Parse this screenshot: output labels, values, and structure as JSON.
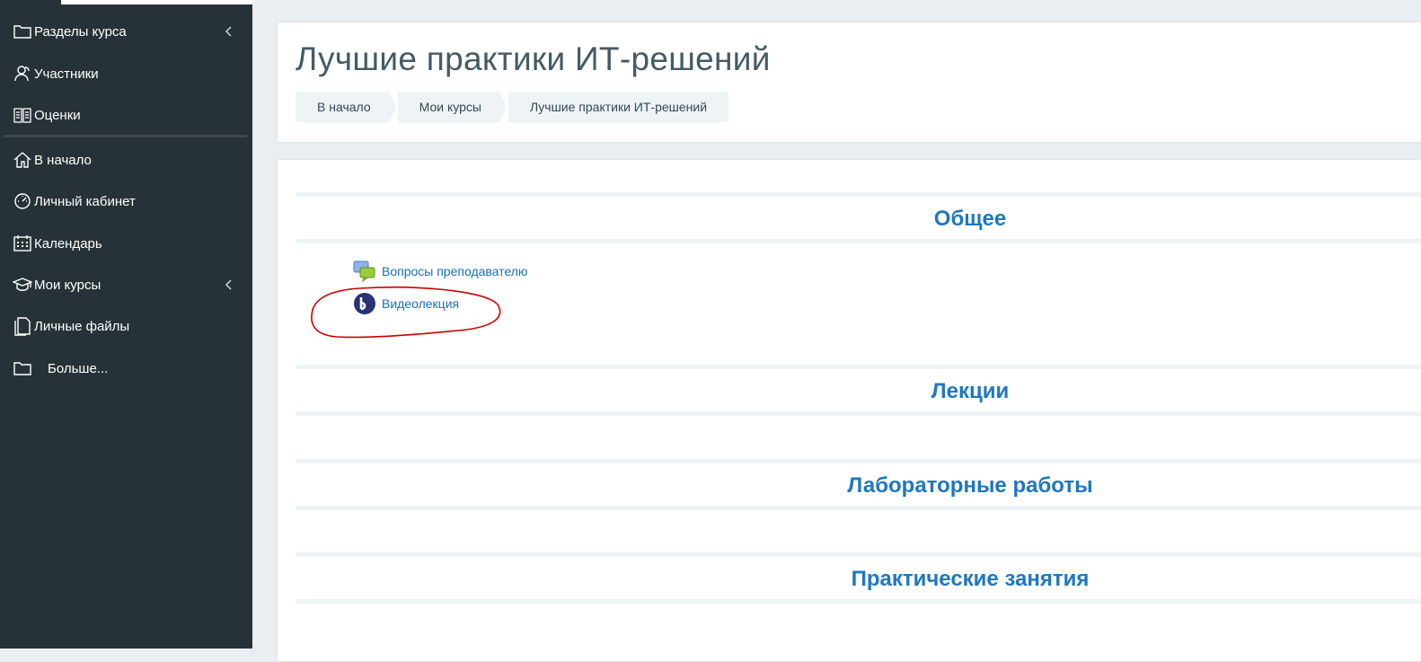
{
  "sidebar": {
    "items": [
      {
        "label": "Разделы курса",
        "icon": "folder-icon",
        "has_chevron": true
      },
      {
        "label": "Участники",
        "icon": "users-icon",
        "has_chevron": false
      },
      {
        "label": "Оценки",
        "icon": "grades-book-icon",
        "has_chevron": false
      },
      {
        "label": "В начало",
        "icon": "home-icon",
        "has_chevron": false
      },
      {
        "label": "Личный кабинет",
        "icon": "dashboard-icon",
        "has_chevron": false
      },
      {
        "label": "Календарь",
        "icon": "calendar-icon",
        "has_chevron": false
      },
      {
        "label": "Мои курсы",
        "icon": "graduation-cap-icon",
        "has_chevron": true
      },
      {
        "label": "Личные файлы",
        "icon": "file-icon",
        "has_chevron": false
      },
      {
        "label": "Больше...",
        "icon": "folder-icon",
        "has_chevron": false
      }
    ]
  },
  "header": {
    "title": "Лучшие практики ИТ-решений",
    "breadcrumb": [
      "В начало",
      "Мои курсы",
      "Лучшие практики ИТ-решений"
    ]
  },
  "sections": [
    {
      "title": "Общее",
      "activities": [
        {
          "label": "Вопросы преподавателю",
          "icon": "forum-chat-icon"
        },
        {
          "label": "Видеолекция",
          "icon": "bigbluebutton-icon"
        }
      ]
    },
    {
      "title": "Лекции",
      "activities": []
    },
    {
      "title": "Лабораторные работы",
      "activities": []
    },
    {
      "title": "Практические занятия",
      "activities": []
    }
  ],
  "colors": {
    "sidebar_bg": "#263238",
    "page_bg": "#e9eef2",
    "title_color": "#455a64",
    "section_title": "#1f77c0",
    "link": "#1a6fb5",
    "annotation": "#cc0000"
  }
}
